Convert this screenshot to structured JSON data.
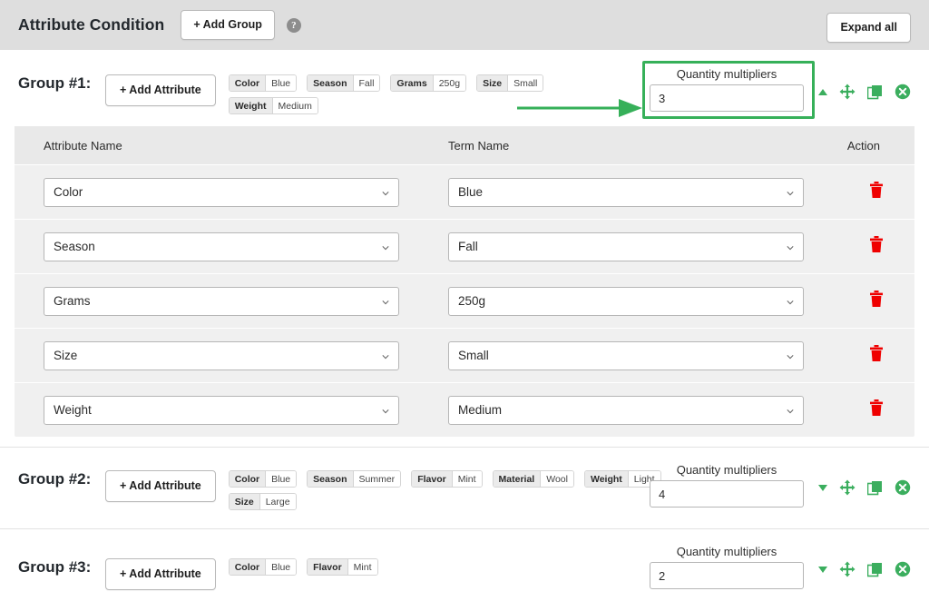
{
  "header": {
    "title": "Attribute Condition",
    "add_group_label": "+ Add Group",
    "help_icon": "help-circle-icon",
    "help_glyph": "?",
    "expand_all_label": "Expand all"
  },
  "accent": {
    "green": "#36b059",
    "red": "#ef0000",
    "header_bg": "#dedede",
    "table_bg": "#f0f0f0"
  },
  "table": {
    "columns": {
      "attribute_name": "Attribute Name",
      "term_name": "Term Name",
      "action": "Action"
    },
    "rows": [
      {
        "attribute": "Color",
        "term": "Blue"
      },
      {
        "attribute": "Season",
        "term": "Fall"
      },
      {
        "attribute": "Grams",
        "term": "250g"
      },
      {
        "attribute": "Size",
        "term": "Small"
      },
      {
        "attribute": "Weight",
        "term": "Medium"
      }
    ]
  },
  "groups": [
    {
      "label": "Group #1:",
      "add_attribute_label": "+ Add Attribute",
      "qty_label": "Quantity multipliers",
      "qty_value": "3",
      "collapse_state": "up",
      "tags": [
        {
          "key": "Color",
          "value": "Blue"
        },
        {
          "key": "Season",
          "value": "Fall"
        },
        {
          "key": "Grams",
          "value": "250g"
        },
        {
          "key": "Size",
          "value": "Small"
        },
        {
          "key": "Weight",
          "value": "Medium"
        }
      ]
    },
    {
      "label": "Group #2:",
      "add_attribute_label": "+ Add Attribute",
      "qty_label": "Quantity multipliers",
      "qty_value": "4",
      "collapse_state": "down",
      "tags": [
        {
          "key": "Color",
          "value": "Blue"
        },
        {
          "key": "Season",
          "value": "Summer"
        },
        {
          "key": "Flavor",
          "value": "Mint"
        },
        {
          "key": "Material",
          "value": "Wool"
        },
        {
          "key": "Weight",
          "value": "Light"
        },
        {
          "key": "Size",
          "value": "Large"
        }
      ]
    },
    {
      "label": "Group #3:",
      "add_attribute_label": "+ Add Attribute",
      "qty_label": "Quantity multipliers",
      "qty_value": "2",
      "collapse_state": "down",
      "tags": [
        {
          "key": "Color",
          "value": "Blue"
        },
        {
          "key": "Flavor",
          "value": "Mint"
        }
      ]
    }
  ],
  "icons": {
    "move": "move-arrows-icon",
    "duplicate": "duplicate-icon",
    "delete_group": "delete-circle-icon",
    "delete_row": "trash-icon",
    "dropdown": "chevron-down-icon"
  },
  "annotation": {
    "highlight_target": "quantity-multipliers-group-1",
    "arrow": "pointer-arrow"
  }
}
